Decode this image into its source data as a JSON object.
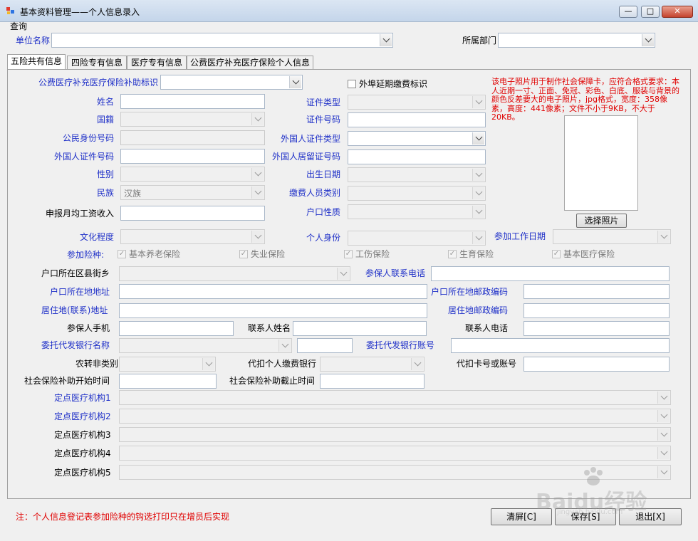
{
  "window": {
    "title": "基本资料管理——个人信息录入",
    "controls": {
      "minimize": "—",
      "maximize": "□",
      "close": "✕"
    }
  },
  "menu": {
    "query": "查询"
  },
  "header": {
    "unit_label": "单位名称",
    "dept_label": "所属部门",
    "unit_value": "",
    "dept_value": ""
  },
  "tabs": [
    "五险共有信息",
    "四险专有信息",
    "医疗专有信息",
    "公费医疗补充医疗保险个人信息"
  ],
  "form": {
    "subsidy_flag_label": "公费医疗补充医疗保险补助标识",
    "outside_delay_label": "外埠延期缴费标识",
    "name_label": "姓名",
    "cert_type_label": "证件类型",
    "nationality_label": "国籍",
    "cert_no_label": "证件号码",
    "citizen_id_label": "公民身份号码",
    "foreign_cert_type_label": "外国人证件类型",
    "foreign_cert_no_label": "外国人证件号码",
    "foreign_residence_label": "外国人居留证号码",
    "gender_label": "性别",
    "birthdate_label": "出生日期",
    "ethnicity_label": "民族",
    "ethnicity_value": "汉族",
    "payer_category_label": "缴费人员类别",
    "monthly_wage_label": "申报月均工资收入",
    "hukou_type_label": "户口性质",
    "education_label": "文化程度",
    "personal_identity_label": "个人身份",
    "work_start_label": "参加工作日期",
    "insurance_label": "参加险种:",
    "insurance_types": [
      "基本养老保险",
      "失业保险",
      "工伤保险",
      "生育保险",
      "基本医疗保险"
    ],
    "hukou_district_label": "户口所在区县街乡",
    "insured_phone_label": "参保人联系电话",
    "hukou_address_label": "户口所在地地址",
    "hukou_postcode_label": "户口所在地邮政编码",
    "residence_address_label": "居住地(联系)地址",
    "residence_postcode_label": "居住地邮政编码",
    "mobile_label": "参保人手机",
    "contact_name_label": "联系人姓名",
    "contact_phone_label": "联系人电话",
    "bank_name_label": "委托代发银行名称",
    "bank_account_label": "委托代发银行账号",
    "agri_label": "农转非类别",
    "deduct_bank_label": "代扣个人缴费银行",
    "deduct_card_label": "代扣卡号或账号",
    "subsidy_start_label": "社会保险补助开始时间",
    "subsidy_end_label": "社会保险补助截止时间",
    "medical_inst_labels": [
      "定点医疗机构1",
      "定点医疗机构2",
      "定点医疗机构3",
      "定点医疗机构4",
      "定点医疗机构5"
    ]
  },
  "photo": {
    "notice": "该电子照片用于制作社会保障卡，应符合格式要求：本人近期一寸、正面、免冠、彩色、白底、服装与背景的颜色反差要大的电子照片，jpg格式，宽度：358像素，高度：441像素；文件不小于9KB，不大于20KB。",
    "select_button": "选择照片"
  },
  "footer": {
    "note": "注：个人信息登记表参加险种的钩选打印只在增员后实现",
    "clear_button": "清屏[C]",
    "save_button": "保存[S]",
    "exit_button": "退出[X]"
  },
  "watermark": {
    "text": "Baidu经验",
    "sub": "jingyan.baidu.com"
  },
  "colors": {
    "label_blue": "#1f30c8",
    "notice_red": "#e00000",
    "titlebar": "#c4d5ea"
  }
}
